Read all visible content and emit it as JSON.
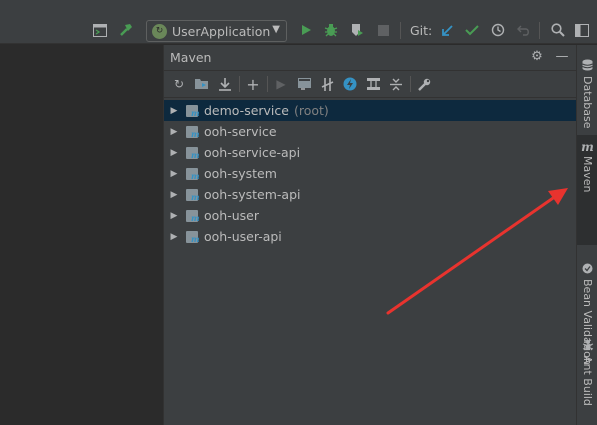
{
  "toolbar": {
    "run_config_label": "UserApplication",
    "git_label": "Git:",
    "icons": [
      "terminal-icon",
      "build-hammer-icon",
      "run-icon",
      "debug-icon",
      "coverage-icon",
      "stop-icon",
      "vcs-update-icon",
      "vcs-commit-icon",
      "history-icon",
      "rollback-icon",
      "search-icon",
      "window-icon"
    ]
  },
  "maven": {
    "title": "Maven",
    "modules": [
      {
        "label": "demo-service",
        "extra": "(root)"
      },
      {
        "label": "ooh-service",
        "extra": ""
      },
      {
        "label": "ooh-service-api",
        "extra": ""
      },
      {
        "label": "ooh-system",
        "extra": ""
      },
      {
        "label": "ooh-system-api",
        "extra": ""
      },
      {
        "label": "ooh-user",
        "extra": ""
      },
      {
        "label": "ooh-user-api",
        "extra": ""
      }
    ]
  },
  "stripe": {
    "database": "Database",
    "maven": "Maven",
    "bean_validation": "Bean Validation",
    "ant_build": "Ant Build"
  },
  "colors": {
    "background": "#3c3f41",
    "selection": "#0d293e",
    "run_green": "#499c54",
    "arrow_red": "#e8332e",
    "vcs_blue": "#3592c4"
  }
}
